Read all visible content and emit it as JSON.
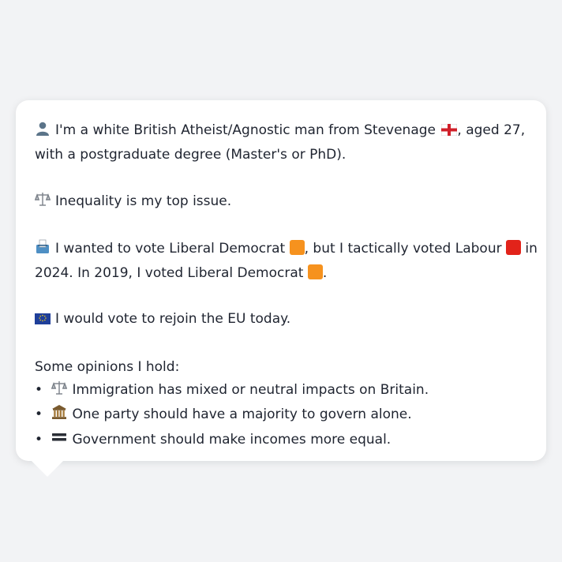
{
  "profile": {
    "line1_text": "I'm a white British Atheist/Agnostic man from Stevenage",
    "line1_suffix": ", aged 27,",
    "line2": "with a postgraduate degree (Master's or PhD).",
    "icon": "person-icon",
    "flag_icon": "england-flag-icon"
  },
  "issue": {
    "text": "Inequality is my top issue.",
    "icon": "scales-icon"
  },
  "vote": {
    "icon": "ballot-box-icon",
    "part1": "I wanted to vote Liberal Democrat",
    "part2": ", but I tactically voted Labour",
    "part3": "in",
    "line2_part1": "2024. In 2019, I voted Liberal Democrat",
    "line2_end": ".",
    "libdem_color": "#f6921e",
    "labour_color": "#e2231a"
  },
  "eu": {
    "icon": "eu-flag-icon",
    "text": "I would vote to rejoin the EU today."
  },
  "opinions": {
    "heading": "Some opinions I hold:",
    "bullet": "•",
    "items": [
      {
        "icon": "scales-icon",
        "text": "Immigration has mixed or neutral impacts on Britain."
      },
      {
        "icon": "classical-building-icon",
        "text": "One party should have a majority to govern alone."
      },
      {
        "icon": "equals-icon",
        "text": "Government should make incomes more equal."
      }
    ]
  }
}
